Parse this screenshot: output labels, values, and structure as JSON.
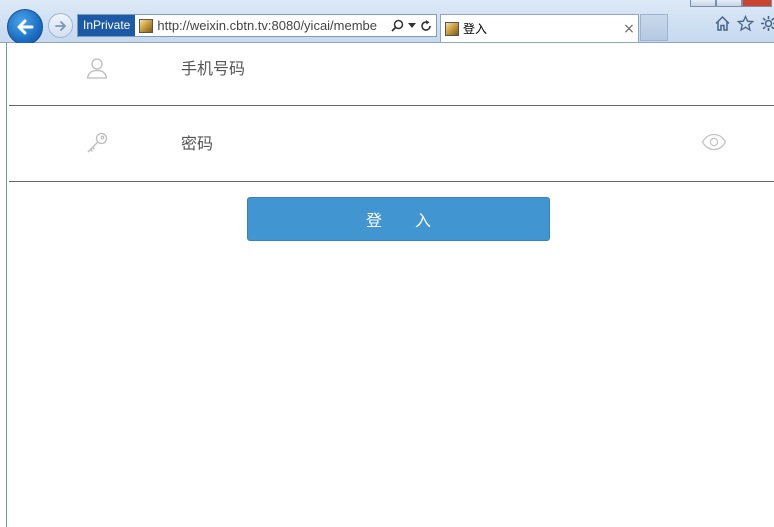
{
  "browser": {
    "inprivate_label": "InPrivate",
    "url": "http://weixin.cbtn.tv:8080/yicai/membe",
    "tab_title": "登入",
    "tab_close": "×"
  },
  "form": {
    "phone_placeholder": "手机号码",
    "password_placeholder": "密码",
    "login_label": "登 入"
  },
  "colors": {
    "login_button": "#4195d0",
    "divider": "#666666",
    "inprivate_badge": "#1c5aa8"
  }
}
